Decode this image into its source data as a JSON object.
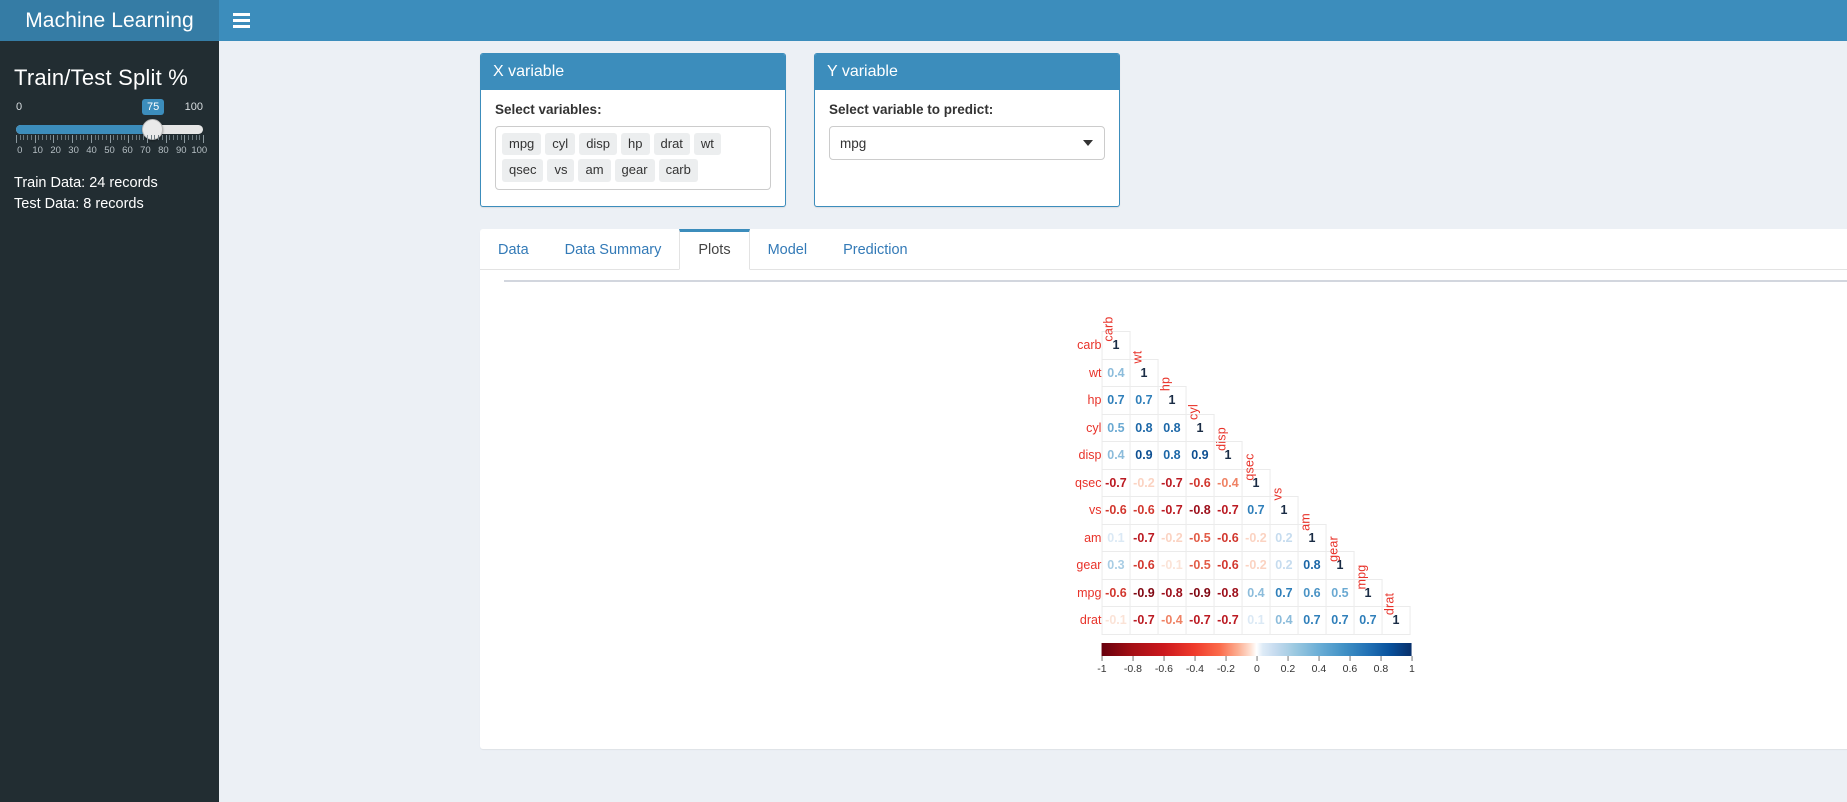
{
  "app": {
    "title": "Machine Learning",
    "menu_icon": "hamburger-icon"
  },
  "sidebar": {
    "heading": "Train/Test Split %",
    "slider": {
      "min_label": "0",
      "max_label": "100",
      "value_label": "75",
      "tick_labels": [
        "0",
        "10",
        "20",
        "30",
        "40",
        "50",
        "60",
        "70",
        "80",
        "90",
        "100"
      ]
    },
    "train_text": "Train Data: 24 records",
    "test_text": "Test Data: 8 records"
  },
  "x_panel": {
    "title": "X variable",
    "label": "Select variables:",
    "tags": [
      "mpg",
      "cyl",
      "disp",
      "hp",
      "drat",
      "wt",
      "qsec",
      "vs",
      "am",
      "gear",
      "carb"
    ]
  },
  "y_panel": {
    "title": "Y variable",
    "label": "Select variable to predict:",
    "selected": "mpg",
    "caret_icon": "chevron-down-icon"
  },
  "tabs": [
    {
      "label": "Data",
      "active": false
    },
    {
      "label": "Data Summary",
      "active": false
    },
    {
      "label": "Plots",
      "active": true
    },
    {
      "label": "Model",
      "active": false
    },
    {
      "label": "Prediction",
      "active": false
    }
  ],
  "chart_data": {
    "type": "heatmap",
    "title": "",
    "subtype": "correlation-matrix-lower-triangle",
    "variables": [
      "carb",
      "wt",
      "hp",
      "cyl",
      "disp",
      "qsec",
      "vs",
      "am",
      "gear",
      "mpg",
      "drat"
    ],
    "rows": [
      "carb",
      "wt",
      "hp",
      "cyl",
      "disp",
      "qsec",
      "vs",
      "am",
      "gear",
      "mpg",
      "drat"
    ],
    "columns": [
      "carb",
      "wt",
      "hp",
      "cyl",
      "disp",
      "qsec",
      "vs",
      "am",
      "gear",
      "mpg",
      "drat"
    ],
    "matrix": [
      [
        1
      ],
      [
        0.4,
        1
      ],
      [
        0.7,
        0.7,
        1
      ],
      [
        0.5,
        0.8,
        0.8,
        1
      ],
      [
        0.4,
        0.9,
        0.8,
        0.9,
        1
      ],
      [
        -0.7,
        -0.2,
        -0.7,
        -0.6,
        -0.4,
        1
      ],
      [
        -0.6,
        -0.6,
        -0.7,
        -0.8,
        -0.7,
        0.7,
        1
      ],
      [
        0.1,
        -0.7,
        -0.2,
        -0.5,
        -0.6,
        -0.2,
        0.2,
        1
      ],
      [
        0.3,
        -0.6,
        -0.1,
        -0.5,
        -0.6,
        -0.2,
        0.2,
        0.8,
        1
      ],
      [
        -0.6,
        -0.9,
        -0.8,
        -0.9,
        -0.8,
        0.4,
        0.7,
        0.6,
        0.5,
        1
      ],
      [
        -0.1,
        -0.7,
        -0.4,
        -0.7,
        -0.7,
        0.1,
        0.4,
        0.7,
        0.7,
        0.7,
        1
      ]
    ],
    "colorscale": {
      "min": -1,
      "max": 1,
      "min_color": "#67000d",
      "mid_color": "#ffffff",
      "max_color": "#08306b"
    },
    "legend": {
      "position": "bottom",
      "tick_labels": [
        "-1",
        "-0.8",
        "-0.6",
        "-0.4",
        "-0.2",
        "0",
        "0.2",
        "0.4",
        "0.6",
        "0.8",
        "1"
      ],
      "tick_values": [
        -1,
        -0.8,
        -0.6,
        -0.4,
        -0.2,
        0,
        0.2,
        0.4,
        0.6,
        0.8,
        1
      ]
    },
    "label_color": "#e8332a"
  },
  "colors": {
    "brand": "#3c8dbc",
    "brand_dark": "#357ca5",
    "sidebar_bg": "#222d32",
    "content_bg": "#ecf0f5"
  }
}
